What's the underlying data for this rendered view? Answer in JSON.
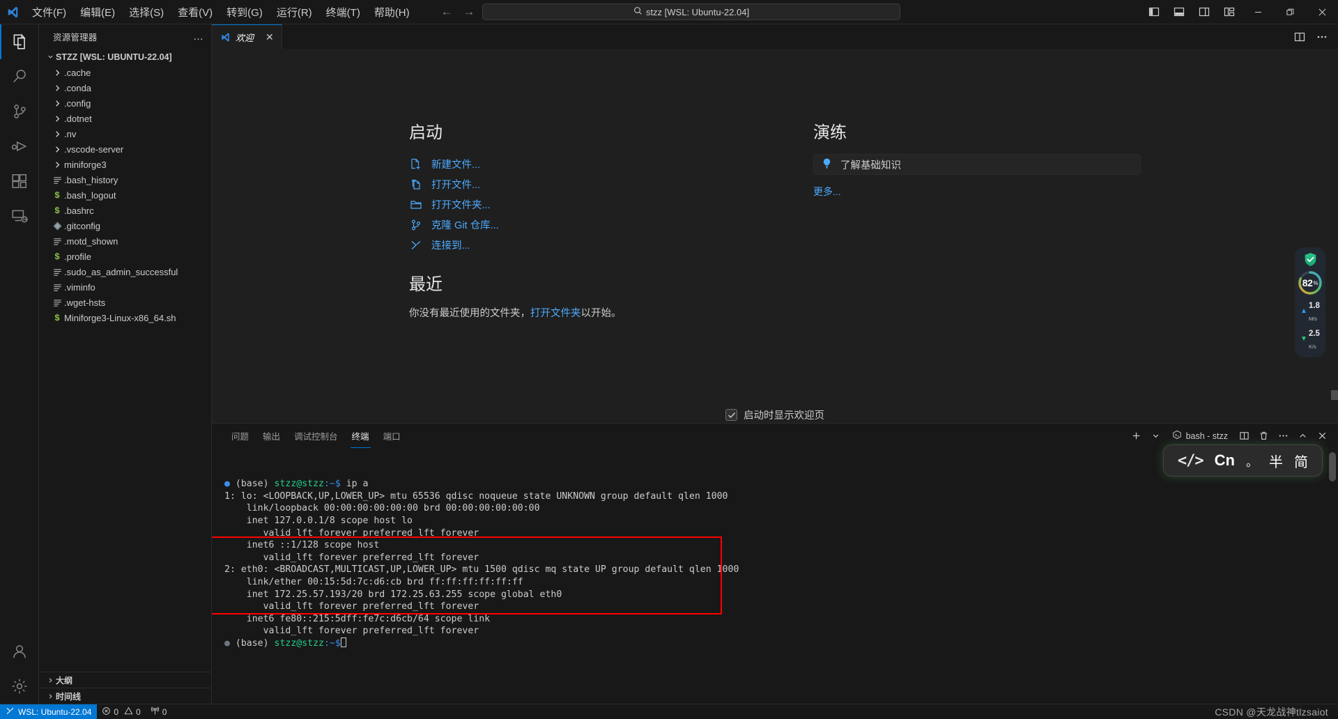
{
  "titlebar": {
    "menus": [
      "文件(F)",
      "编辑(E)",
      "选择(S)",
      "查看(V)",
      "转到(G)",
      "运行(R)",
      "终端(T)",
      "帮助(H)"
    ],
    "back_label": "←",
    "forward_label": "→",
    "quickpick_value": "stzz [WSL: Ubuntu-22.04]",
    "layout_buttons": [
      "toggle-primary-sidebar",
      "toggle-panel",
      "toggle-secondary-sidebar",
      "customize-layout"
    ],
    "window_buttons": [
      "minimize",
      "restore",
      "close"
    ]
  },
  "activitybar": {
    "items": [
      {
        "name": "explorer",
        "label": "资源管理器",
        "active": true
      },
      {
        "name": "search",
        "label": "搜索",
        "active": false
      },
      {
        "name": "source-control",
        "label": "源代码管理",
        "active": false
      },
      {
        "name": "run-debug",
        "label": "运行和调试",
        "active": false
      },
      {
        "name": "extensions",
        "label": "扩展",
        "active": false
      },
      {
        "name": "remote-explorer",
        "label": "远程资源管理器",
        "active": false
      }
    ],
    "bottom": [
      {
        "name": "accounts",
        "label": "账户"
      },
      {
        "name": "settings",
        "label": "管理"
      }
    ]
  },
  "sidebar": {
    "title": "资源管理器",
    "more_label": "…",
    "root": "STZZ [WSL: UBUNTU-22.04]",
    "files": [
      {
        "name": ".cache",
        "type": "folder"
      },
      {
        "name": ".conda",
        "type": "folder"
      },
      {
        "name": ".config",
        "type": "folder"
      },
      {
        "name": ".dotnet",
        "type": "folder"
      },
      {
        "name": ".nv",
        "type": "folder"
      },
      {
        "name": ".vscode-server",
        "type": "folder"
      },
      {
        "name": "miniforge3",
        "type": "folder"
      },
      {
        "name": ".bash_history",
        "type": "text"
      },
      {
        "name": ".bash_logout",
        "type": "shell"
      },
      {
        "name": ".bashrc",
        "type": "shell"
      },
      {
        "name": ".gitconfig",
        "type": "git"
      },
      {
        "name": ".motd_shown",
        "type": "text"
      },
      {
        "name": ".profile",
        "type": "shell"
      },
      {
        "name": ".sudo_as_admin_successful",
        "type": "text"
      },
      {
        "name": ".viminfo",
        "type": "text"
      },
      {
        "name": ".wget-hsts",
        "type": "text"
      },
      {
        "name": "Miniforge3-Linux-x86_64.sh",
        "type": "shell"
      }
    ],
    "sections": [
      "大纲",
      "时间线"
    ]
  },
  "editor": {
    "tab_label": "欢迎",
    "tab_close": "✕",
    "actions": [
      "split-editor",
      "more-actions"
    ]
  },
  "welcome": {
    "start": {
      "heading": "启动",
      "links": [
        {
          "label": "新建文件...",
          "icon": "new-file-icon"
        },
        {
          "label": "打开文件...",
          "icon": "open-file-icon"
        },
        {
          "label": "打开文件夹...",
          "icon": "folder-open-icon"
        },
        {
          "label": "克隆 Git 仓库...",
          "icon": "git-branch-icon"
        },
        {
          "label": "连接到...",
          "icon": "remote-connect-icon"
        }
      ]
    },
    "recent": {
      "heading": "最近",
      "text_before": "你没有最近使用的文件夹，",
      "link": "打开文件夹",
      "text_after": "以开始。"
    },
    "walkthroughs": {
      "heading": "演练",
      "card_label": "了解基础知识",
      "card_icon": "lightbulb-icon",
      "more_label": "更多..."
    },
    "startup_checkbox": {
      "checked": true,
      "label": "启动时显示欢迎页"
    }
  },
  "panel": {
    "tabs": [
      {
        "label": "问题",
        "active": false
      },
      {
        "label": "输出",
        "active": false
      },
      {
        "label": "调试控制台",
        "active": false
      },
      {
        "label": "终端",
        "active": true
      },
      {
        "label": "端口",
        "active": false
      }
    ],
    "actions": {
      "new_terminal": "+",
      "new_terminal_dropdown": "⌄",
      "terminal_tab": "bash - stzz",
      "split": "split-terminal",
      "kill": "kill-terminal",
      "more": "…",
      "maximize": "⌃",
      "close": "✕"
    }
  },
  "terminal": {
    "command": "ip a",
    "prompt_env": "(base)",
    "prompt_user": "stzz@stzz",
    "prompt_path": ":~$",
    "lines": [
      {
        "type": "prompt",
        "env": "(base)",
        "user": "stzz@stzz",
        "path": ":~$",
        "cmd": " ip a"
      },
      {
        "type": "out",
        "text": "1: lo: <LOOPBACK,UP,LOWER_UP> mtu 65536 qdisc noqueue state UNKNOWN group default qlen 1000"
      },
      {
        "type": "out",
        "text": "    link/loopback 00:00:00:00:00:00 brd 00:00:00:00:00:00"
      },
      {
        "type": "out",
        "text": "    inet 127.0.0.1/8 scope host lo"
      },
      {
        "type": "out",
        "text": "       valid_lft forever preferred_lft forever"
      },
      {
        "type": "out",
        "text": "    inet6 ::1/128 scope host"
      },
      {
        "type": "out",
        "text": "       valid_lft forever preferred_lft forever"
      },
      {
        "type": "out",
        "text": "2: eth0: <BROADCAST,MULTICAST,UP,LOWER_UP> mtu 1500 qdisc mq state UP group default qlen 1000"
      },
      {
        "type": "out",
        "text": "    link/ether 00:15:5d:7c:d6:cb brd ff:ff:ff:ff:ff:ff"
      },
      {
        "type": "out",
        "text": "    inet 172.25.57.193/20 brd 172.25.63.255 scope global eth0"
      },
      {
        "type": "out",
        "text": "       valid_lft forever preferred_lft forever"
      },
      {
        "type": "out",
        "text": "    inet6 fe80::215:5dff:fe7c:d6cb/64 scope link"
      },
      {
        "type": "out",
        "text": "       valid_lft forever preferred_lft forever"
      }
    ],
    "final_prompt": {
      "env": "(base)",
      "user": "stzz@stzz",
      "path": ":~$"
    },
    "highlight_color": "#ff0000"
  },
  "statusbar": {
    "remote_label": "WSL: Ubuntu-22.04",
    "errors": "0",
    "warnings": "0",
    "ports": "0",
    "watermark": "CSDN @天龙战神tlzsaiot"
  },
  "netwidget": {
    "shield_state": "protected",
    "cpu_percent": "82",
    "percent_symbol": "%",
    "upload_value": "1.8",
    "upload_unit": "M/s",
    "download_value": "2.5",
    "download_unit": "K/s"
  },
  "imebar": {
    "mode_icon": "</>",
    "language": "Cn",
    "punctuation": "。",
    "width_mode": "半",
    "script_mode": "简"
  }
}
